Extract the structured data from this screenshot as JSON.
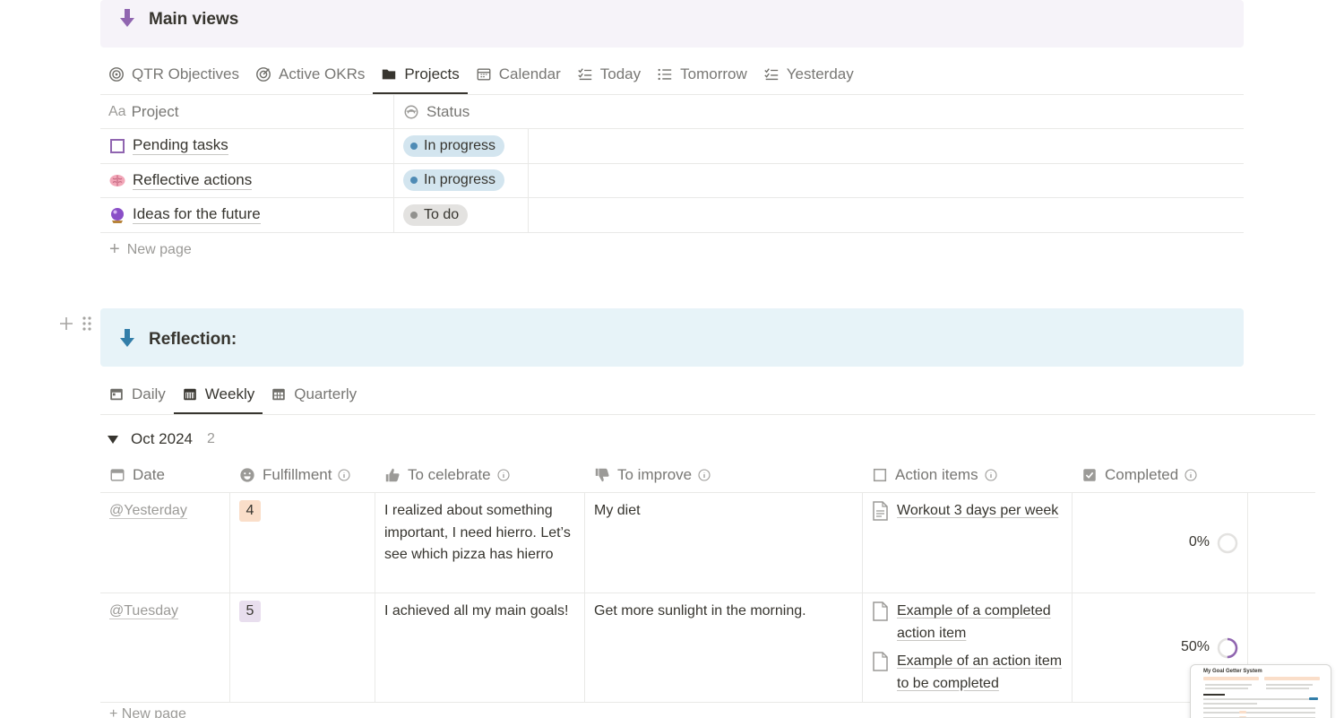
{
  "main_callout": {
    "title": "Main views"
  },
  "main_tabs": [
    {
      "label": "QTR Objectives",
      "icon": "target-icon"
    },
    {
      "label": "Active OKRs",
      "icon": "target-icon"
    },
    {
      "label": "Projects",
      "icon": "folder-icon",
      "active": true
    },
    {
      "label": "Calendar",
      "icon": "calendar-icon"
    },
    {
      "label": "Today",
      "icon": "checklist-icon"
    },
    {
      "label": "Tomorrow",
      "icon": "list-icon"
    },
    {
      "label": "Yesterday",
      "icon": "checklist-icon"
    }
  ],
  "projects": {
    "columns": {
      "name": "Project",
      "status": "Status",
      "name_prefix": "Aa"
    },
    "rows": [
      {
        "name": "Pending tasks",
        "status": "In progress",
        "icon": "checkbox-icon"
      },
      {
        "name": "Reflective actions",
        "status": "In progress",
        "icon": "brain-icon"
      },
      {
        "name": "Ideas for the future",
        "status": "To do",
        "icon": "crystal-ball-icon"
      }
    ],
    "new_page": "New page"
  },
  "reflection_callout": {
    "title": "Reflection:"
  },
  "reflection_tabs": [
    {
      "label": "Daily",
      "icon": "calendar-icon"
    },
    {
      "label": "Weekly",
      "icon": "calendar-icon",
      "active": true
    },
    {
      "label": "Quarterly",
      "icon": "calendar-grid-icon"
    }
  ],
  "group": {
    "title": "Oct 2024",
    "count": "2"
  },
  "reflection": {
    "columns": {
      "date": "Date",
      "fulfillment": "Fulfillment",
      "celebrate": "To celebrate",
      "improve": "To improve",
      "actions": "Action items",
      "completed": "Completed"
    },
    "rows": [
      {
        "date": "@Yesterday",
        "fulfillment": "4",
        "celebrate": "I realized about something important, I need hierro. Let’s see which pizza has hierro",
        "improve": "My diet",
        "actions": [
          "Workout 3 days per week"
        ],
        "completed": "0%",
        "progress": 0
      },
      {
        "date": "@Tuesday",
        "fulfillment": "5",
        "celebrate": "I achieved all my main goals!",
        "improve": "Get more sunlight in the morning.",
        "actions": [
          "Example of a completed action item",
          "Example of an action item to be completed"
        ],
        "completed": "50%",
        "progress": 0.5
      }
    ],
    "new_page": "New page"
  },
  "thumbnail": {
    "title": "My Goal Getter System"
  },
  "colors": {
    "purple_accent": "#9065b0",
    "blue_accent": "#337ea9",
    "status_blue": "#d3e5ef",
    "status_gray": "#e3e2e0"
  }
}
